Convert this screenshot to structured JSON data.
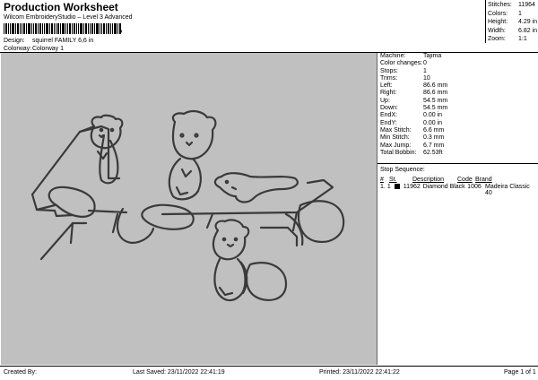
{
  "header": {
    "title": "Production Worksheet",
    "subtitle": "Wilcom EmbroideryStudio – Level 3 Advanced",
    "barcode_suffix": ","
  },
  "info": {
    "design_label": "Design:",
    "design_value": "squirrel FAMILY 6,6 in",
    "colorway_label": "Colorway:",
    "colorway_value": "Colorway 1"
  },
  "stats": {
    "stitches_label": "Stitches:",
    "stitches_value": "11964",
    "colors_label": "Colors:",
    "colors_value": "1",
    "height_label": "Height:",
    "height_value": "4.29 in",
    "width_label": "Width:",
    "width_value": "6.82 in",
    "zoom_label": "Zoom:",
    "zoom_value": "1:1"
  },
  "props": [
    {
      "label": "Machine:",
      "value": "Tajima"
    },
    {
      "label": "Color changes:",
      "value": "0"
    },
    {
      "label": "Stops:",
      "value": "1"
    },
    {
      "label": "Trims:",
      "value": "10"
    },
    {
      "label": "Left:",
      "value": "86.6 mm"
    },
    {
      "label": "Right:",
      "value": "86.6 mm"
    },
    {
      "label": "Up:",
      "value": "54.5 mm"
    },
    {
      "label": "Down:",
      "value": "54.5 mm"
    },
    {
      "label": "EndX:",
      "value": "0.00 in"
    },
    {
      "label": "EndY:",
      "value": "0.00 in"
    },
    {
      "label": "Max Stitch:",
      "value": "6.6 mm"
    },
    {
      "label": "Min Stitch:",
      "value": "0.3 mm"
    },
    {
      "label": "Max Jump:",
      "value": "6.7 mm"
    },
    {
      "label": "Total Bobbin:",
      "value": "62.53ft"
    }
  ],
  "sequence": {
    "title": "Stop Sequence:",
    "headers": [
      "#",
      "St.",
      "Description",
      "Code",
      "Brand"
    ],
    "rows": [
      {
        "num": "1.",
        "stop": "1",
        "stitches": "11962",
        "description": "Diamond Black",
        "code": "1006",
        "brand": "Madeira Classic 40",
        "swatch": "#000000"
      }
    ]
  },
  "footer": {
    "created": "Created By:",
    "saved": "Last Saved: 23/11/2022 22:41:19",
    "printed": "Printed: 23/11/2022 22:41:22",
    "page": "Page 1 of 1"
  },
  "colors": {
    "canvas_bg": "#c0c0c0",
    "outline": "#3a3a3a"
  }
}
